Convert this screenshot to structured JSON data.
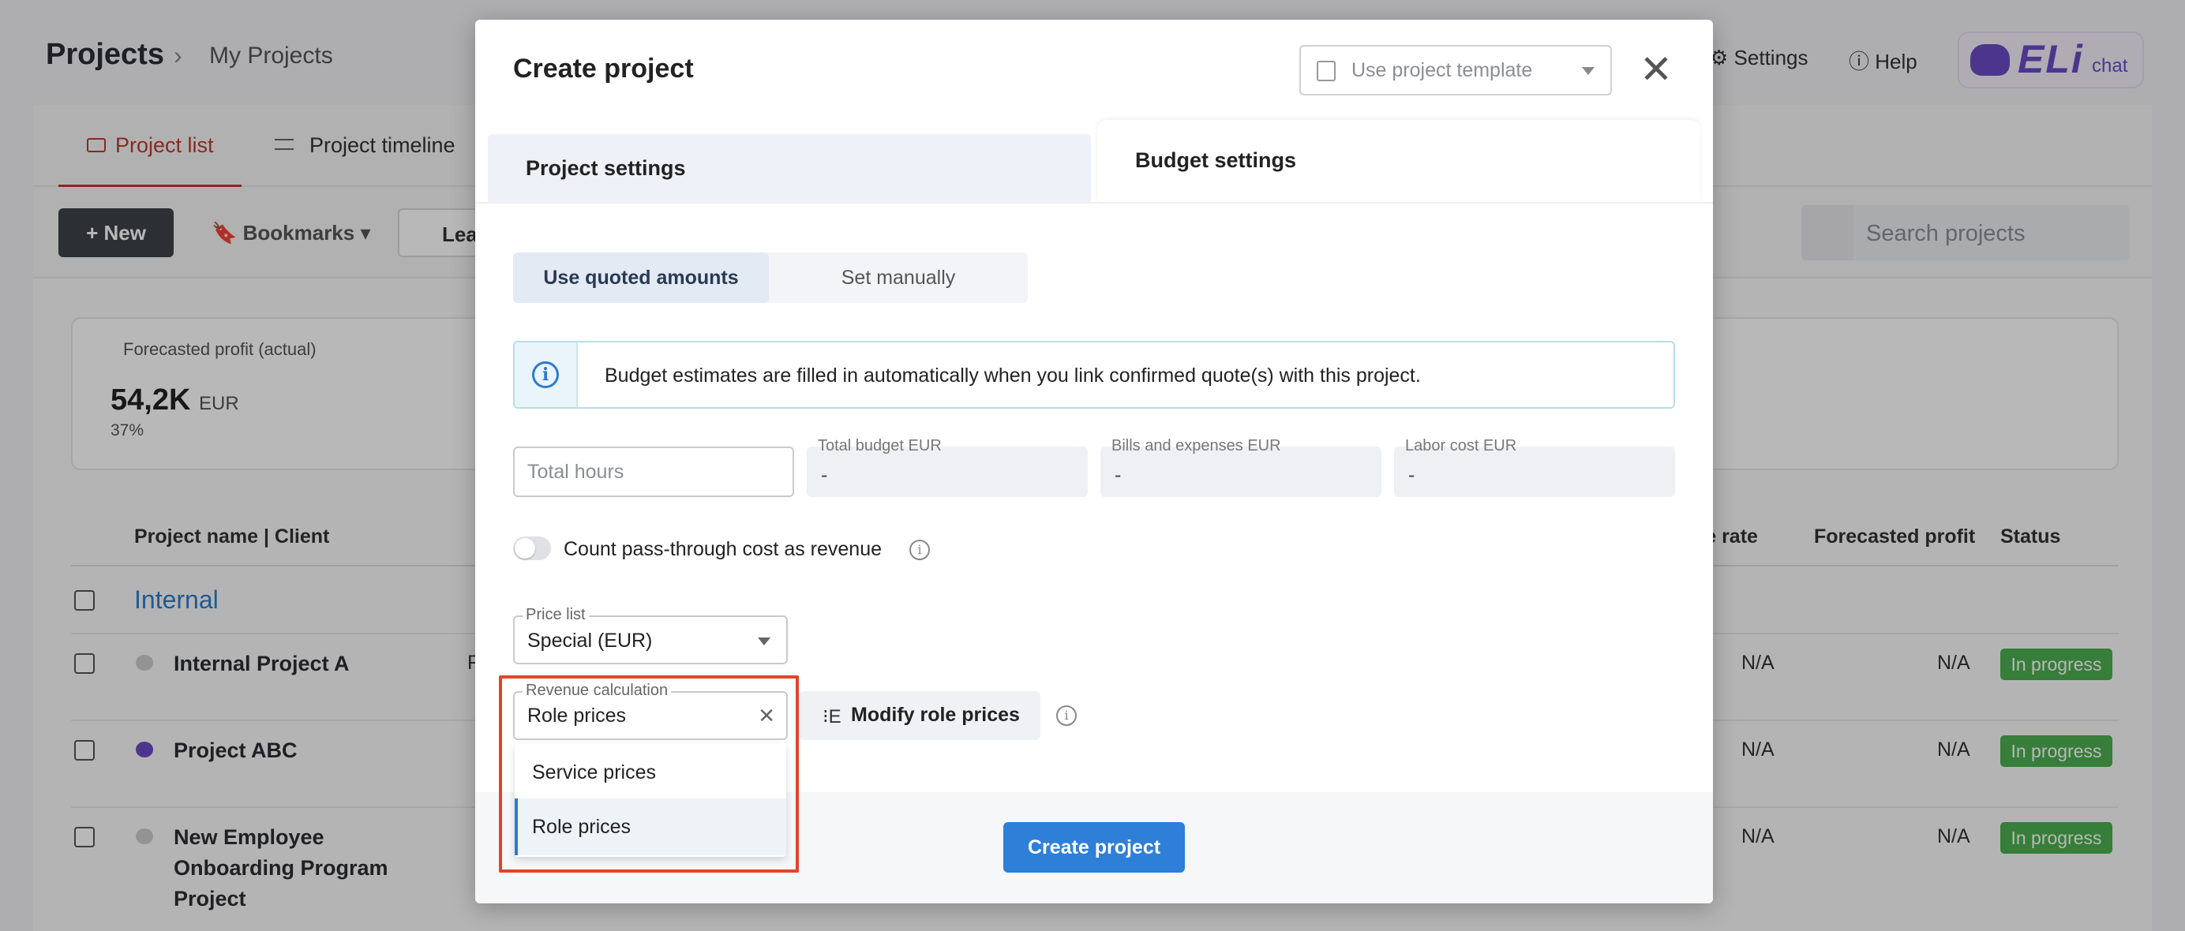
{
  "header": {
    "title": "Projects",
    "breadcrumb_sep": "›",
    "breadcrumb": "My Projects",
    "settings_label": "Settings",
    "help_label": "Help",
    "eli_logo": "ELi",
    "eli_chat": "chat"
  },
  "tabs": [
    {
      "label": "Project list",
      "active": true
    },
    {
      "label": "Project timeline",
      "active": false
    }
  ],
  "toolbar": {
    "new_label": "+ New",
    "bookmarks_label": "Bookmarks",
    "lead_label": "Lea",
    "search_placeholder": "Search projects"
  },
  "kpi": {
    "label": "Forecasted profit (actual)",
    "value": "54,2K",
    "unit": "EUR",
    "percent": "37%"
  },
  "table": {
    "columns": [
      "Project name | Client",
      "ble rate",
      "Forecasted profit",
      "Status"
    ],
    "group": "Internal",
    "rows": [
      {
        "name": "Internal Project A",
        "col_trunc": "F",
        "rate": "N/A",
        "profit": "N/A",
        "status": "In progress"
      },
      {
        "name": "Project ABC",
        "rate": "N/A",
        "profit": "N/A",
        "status": "In progress"
      },
      {
        "name_lines": [
          "New Employee",
          "Onboarding Program",
          "Project"
        ],
        "rate": "N/A",
        "profit": "N/A",
        "status": "In progress"
      }
    ]
  },
  "modal": {
    "title": "Create project",
    "template_placeholder": "Use project template",
    "close_glyph": "✕",
    "tab_project_settings": "Project settings",
    "tab_budget_settings": "Budget settings",
    "segment": {
      "quoted": "Use quoted amounts",
      "manual": "Set manually",
      "selected": "quoted"
    },
    "info_text": "Budget estimates are filled in automatically when you link confirmed quote(s) with this project.",
    "total_hours_placeholder": "Total hours",
    "fields": [
      {
        "label": "Total budget EUR",
        "value": "-"
      },
      {
        "label": "Bills and expenses EUR",
        "value": "-"
      },
      {
        "label": "Labor cost EUR",
        "value": "-"
      }
    ],
    "pass_through_label": "Count pass-through cost as revenue",
    "pass_through_on": false,
    "price_list": {
      "label": "Price list",
      "value": "Special (EUR)"
    },
    "revenue_calc": {
      "label": "Revenue calculation",
      "value": "Role prices",
      "options": [
        "Service prices",
        "Role prices"
      ],
      "selected": "Role prices"
    },
    "modify_label": "Modify role prices",
    "create_label": "Create project"
  },
  "colors": {
    "accent": "#2e7fd8",
    "active_tab": "#c0392b",
    "status_green": "#4caf50",
    "highlight": "#e0452b"
  }
}
